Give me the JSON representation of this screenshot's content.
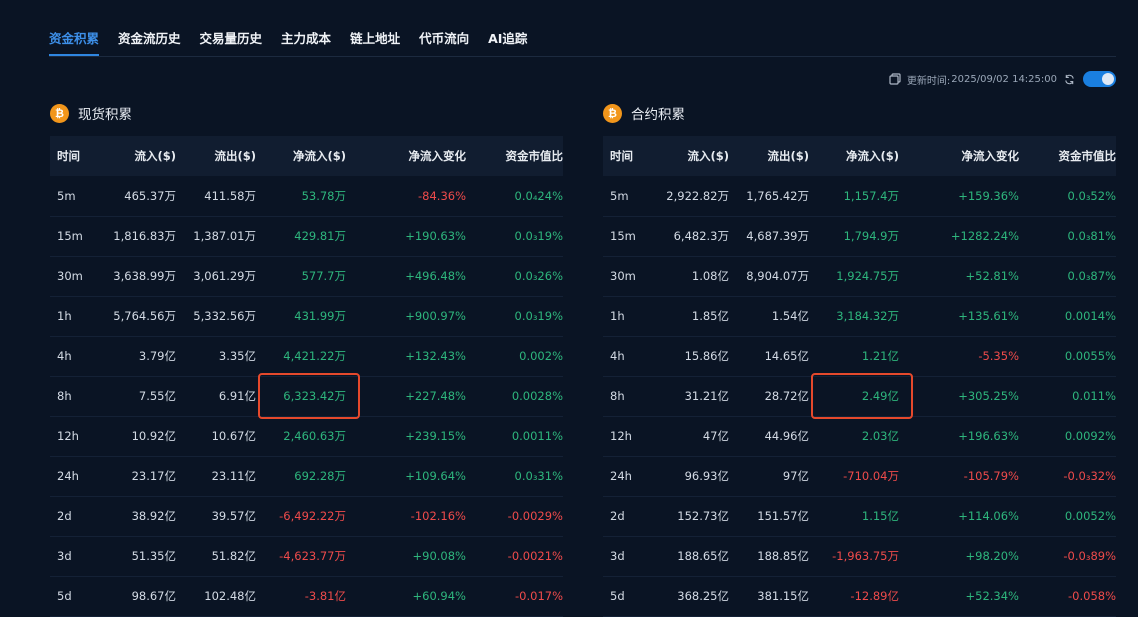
{
  "tabs": [
    "资金积累",
    "资金流历史",
    "交易量历史",
    "主力成本",
    "链上地址",
    "代币流向",
    "AI追踪"
  ],
  "active_tab": 0,
  "update": {
    "label": "更新时间:",
    "time": "2025/09/02 14:25:00"
  },
  "colors": {
    "positive": "#2eb67d",
    "negative": "#ef4b4b",
    "accent": "#2f86e0",
    "highlight": "#e5492c"
  },
  "icons": {
    "coin": "bitcoin-icon",
    "copy": "copy-icon",
    "refresh": "refresh-icon",
    "toggle": "toggle-switch"
  },
  "panels": [
    {
      "title": "现货积累",
      "coin_symbol": "₿",
      "columns": [
        "时间",
        "流入($)",
        "流出($)",
        "净流入($)",
        "净流入变化",
        "资金市值比"
      ],
      "rows": [
        {
          "time": "5m",
          "inflow": "465.37万",
          "outflow": "411.58万",
          "net": "53.78万",
          "change": "-84.36%",
          "ratio": "0.0₄24%"
        },
        {
          "time": "15m",
          "inflow": "1,816.83万",
          "outflow": "1,387.01万",
          "net": "429.81万",
          "change": "+190.63%",
          "ratio": "0.0₃19%"
        },
        {
          "time": "30m",
          "inflow": "3,638.99万",
          "outflow": "3,061.29万",
          "net": "577.7万",
          "change": "+496.48%",
          "ratio": "0.0₃26%"
        },
        {
          "time": "1h",
          "inflow": "5,764.56万",
          "outflow": "5,332.56万",
          "net": "431.99万",
          "change": "+900.97%",
          "ratio": "0.0₃19%"
        },
        {
          "time": "4h",
          "inflow": "3.79亿",
          "outflow": "3.35亿",
          "net": "4,421.22万",
          "change": "+132.43%",
          "ratio": "0.002%"
        },
        {
          "time": "8h",
          "inflow": "7.55亿",
          "outflow": "6.91亿",
          "net": "6,323.42万",
          "change": "+227.48%",
          "ratio": "0.0028%"
        },
        {
          "time": "12h",
          "inflow": "10.92亿",
          "outflow": "10.67亿",
          "net": "2,460.63万",
          "change": "+239.15%",
          "ratio": "0.0011%"
        },
        {
          "time": "24h",
          "inflow": "23.17亿",
          "outflow": "23.11亿",
          "net": "692.28万",
          "change": "+109.64%",
          "ratio": "0.0₃31%"
        },
        {
          "time": "2d",
          "inflow": "38.92亿",
          "outflow": "39.57亿",
          "net": "-6,492.22万",
          "change": "-102.16%",
          "ratio": "-0.0029%"
        },
        {
          "time": "3d",
          "inflow": "51.35亿",
          "outflow": "51.82亿",
          "net": "-4,623.77万",
          "change": "+90.08%",
          "ratio": "-0.0021%"
        },
        {
          "time": "5d",
          "inflow": "98.67亿",
          "outflow": "102.48亿",
          "net": "-3.81亿",
          "change": "+60.94%",
          "ratio": "-0.017%"
        }
      ]
    },
    {
      "title": "合约积累",
      "coin_symbol": "₿",
      "columns": [
        "时间",
        "流入($)",
        "流出($)",
        "净流入($)",
        "净流入变化",
        "资金市值比"
      ],
      "rows": [
        {
          "time": "5m",
          "inflow": "2,922.82万",
          "outflow": "1,765.42万",
          "net": "1,157.4万",
          "change": "+159.36%",
          "ratio": "0.0₃52%"
        },
        {
          "time": "15m",
          "inflow": "6,482.3万",
          "outflow": "4,687.39万",
          "net": "1,794.9万",
          "change": "+1282.24%",
          "ratio": "0.0₃81%"
        },
        {
          "time": "30m",
          "inflow": "1.08亿",
          "outflow": "8,904.07万",
          "net": "1,924.75万",
          "change": "+52.81%",
          "ratio": "0.0₃87%"
        },
        {
          "time": "1h",
          "inflow": "1.85亿",
          "outflow": "1.54亿",
          "net": "3,184.32万",
          "change": "+135.61%",
          "ratio": "0.0014%"
        },
        {
          "time": "4h",
          "inflow": "15.86亿",
          "outflow": "14.65亿",
          "net": "1.21亿",
          "change": "-5.35%",
          "ratio": "0.0055%"
        },
        {
          "time": "8h",
          "inflow": "31.21亿",
          "outflow": "28.72亿",
          "net": "2.49亿",
          "change": "+305.25%",
          "ratio": "0.011%"
        },
        {
          "time": "12h",
          "inflow": "47亿",
          "outflow": "44.96亿",
          "net": "2.03亿",
          "change": "+196.63%",
          "ratio": "0.0092%"
        },
        {
          "time": "24h",
          "inflow": "96.93亿",
          "outflow": "97亿",
          "net": "-710.04万",
          "change": "-105.79%",
          "ratio": "-0.0₃32%"
        },
        {
          "time": "2d",
          "inflow": "152.73亿",
          "outflow": "151.57亿",
          "net": "1.15亿",
          "change": "+114.06%",
          "ratio": "0.0052%"
        },
        {
          "time": "3d",
          "inflow": "188.65亿",
          "outflow": "188.85亿",
          "net": "-1,963.75万",
          "change": "+98.20%",
          "ratio": "-0.0₃89%"
        },
        {
          "time": "5d",
          "inflow": "368.25亿",
          "outflow": "381.15亿",
          "net": "-12.89亿",
          "change": "+52.34%",
          "ratio": "-0.058%"
        }
      ]
    }
  ]
}
